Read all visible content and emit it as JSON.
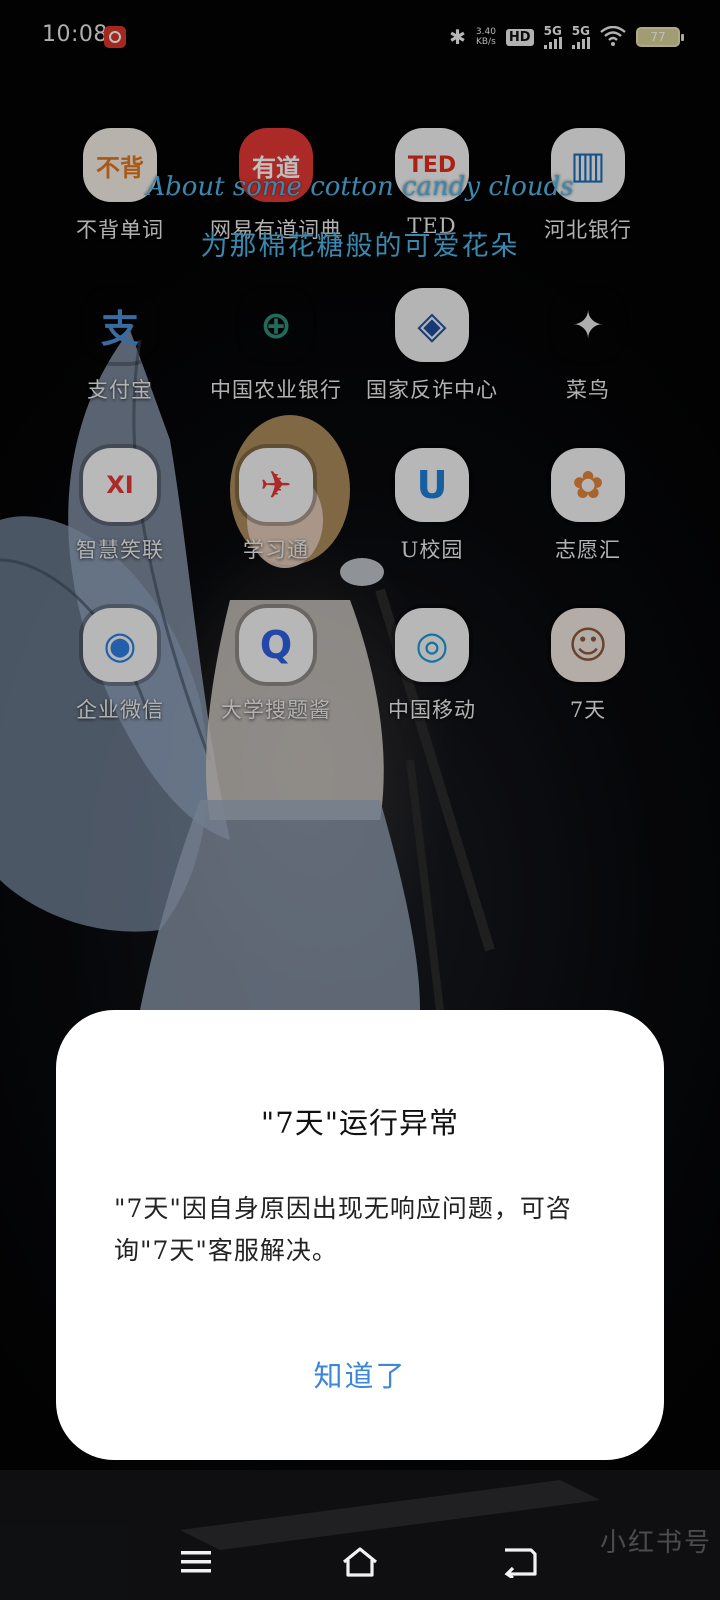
{
  "status_bar": {
    "time": "10:08",
    "net_speed_value": "3.40",
    "net_speed_unit": "KB/s",
    "hd_label": "HD",
    "sim1_label": "5G",
    "sim2_label": "5G",
    "battery_level": "77"
  },
  "widget": {
    "lyric_en": "About some cotton candy clouds",
    "lyric_zh": "为那棉花糖般的可爱花朵"
  },
  "apps": [
    {
      "label": "不背单词",
      "icon": "bubei-icon",
      "glyph": "不背",
      "bg": "#f4efe6",
      "fg": "#e2771e"
    },
    {
      "label": "网易有道词典",
      "icon": "youdao-icon",
      "glyph": "有道",
      "bg": "#e53935",
      "fg": "#ffffff"
    },
    {
      "label": "TED",
      "icon": "ted-icon",
      "glyph": "TED",
      "bg": "#f5f5f5",
      "fg": "#e62b1e"
    },
    {
      "label": "河北银行",
      "icon": "hebei-bank-icon",
      "glyph": "▥",
      "bg": "#f3f3f3",
      "fg": "#1c6fb8"
    },
    {
      "label": "支付宝",
      "icon": "alipay-icon",
      "glyph": "支",
      "bg": "rgba(0,0,0,0)",
      "fg": "#4d8fd6"
    },
    {
      "label": "中国农业银行",
      "icon": "abc-bank-icon",
      "glyph": "⊕",
      "bg": "rgba(0,0,0,0)",
      "fg": "#2d8f7b"
    },
    {
      "label": "国家反诈中心",
      "icon": "anti-fraud-icon",
      "glyph": "◈",
      "bg": "#f1f1f1",
      "fg": "#1f4d9c"
    },
    {
      "label": "菜鸟",
      "icon": "cainiao-icon",
      "glyph": "✦",
      "bg": "rgba(0,0,0,0)",
      "fg": "#e8e8e8"
    },
    {
      "label": "智慧笑联",
      "icon": "zhihui-icon",
      "glyph": "XI",
      "bg": "#f7f7f7",
      "fg": "#e53935"
    },
    {
      "label": "学习通",
      "icon": "xuexitong-icon",
      "glyph": "✈",
      "bg": "#f4f4f4",
      "fg": "#e53935"
    },
    {
      "label": "U校园",
      "icon": "u-campus-icon",
      "glyph": "U",
      "bg": "#f4f4f4",
      "fg": "#1f7fd6"
    },
    {
      "label": "志愿汇",
      "icon": "zhiyuanhui-icon",
      "glyph": "✿",
      "bg": "#f4f4f4",
      "fg": "#e0863a"
    },
    {
      "label": "企业微信",
      "icon": "wecom-icon",
      "glyph": "◉",
      "bg": "#f4f4f4",
      "fg": "#2f7fe0"
    },
    {
      "label": "大学搜题酱",
      "icon": "soutijiang-icon",
      "glyph": "Q",
      "bg": "#f4f4f4",
      "fg": "#2f5fe0"
    },
    {
      "label": "中国移动",
      "icon": "china-mobile-icon",
      "glyph": "◎",
      "bg": "#f4f4f4",
      "fg": "#1d9bd6"
    },
    {
      "label": "7天",
      "icon": "seven-days-icon",
      "glyph": "☺",
      "bg": "#efe6df",
      "fg": "#8b5a3c"
    }
  ],
  "dialog": {
    "title": "\"7天\"运行异常",
    "body": "\"7天\"因自身原因出现无响应问题，可咨询\"7天\"客服解决。",
    "button": "知道了"
  },
  "watermark": "小红书号"
}
